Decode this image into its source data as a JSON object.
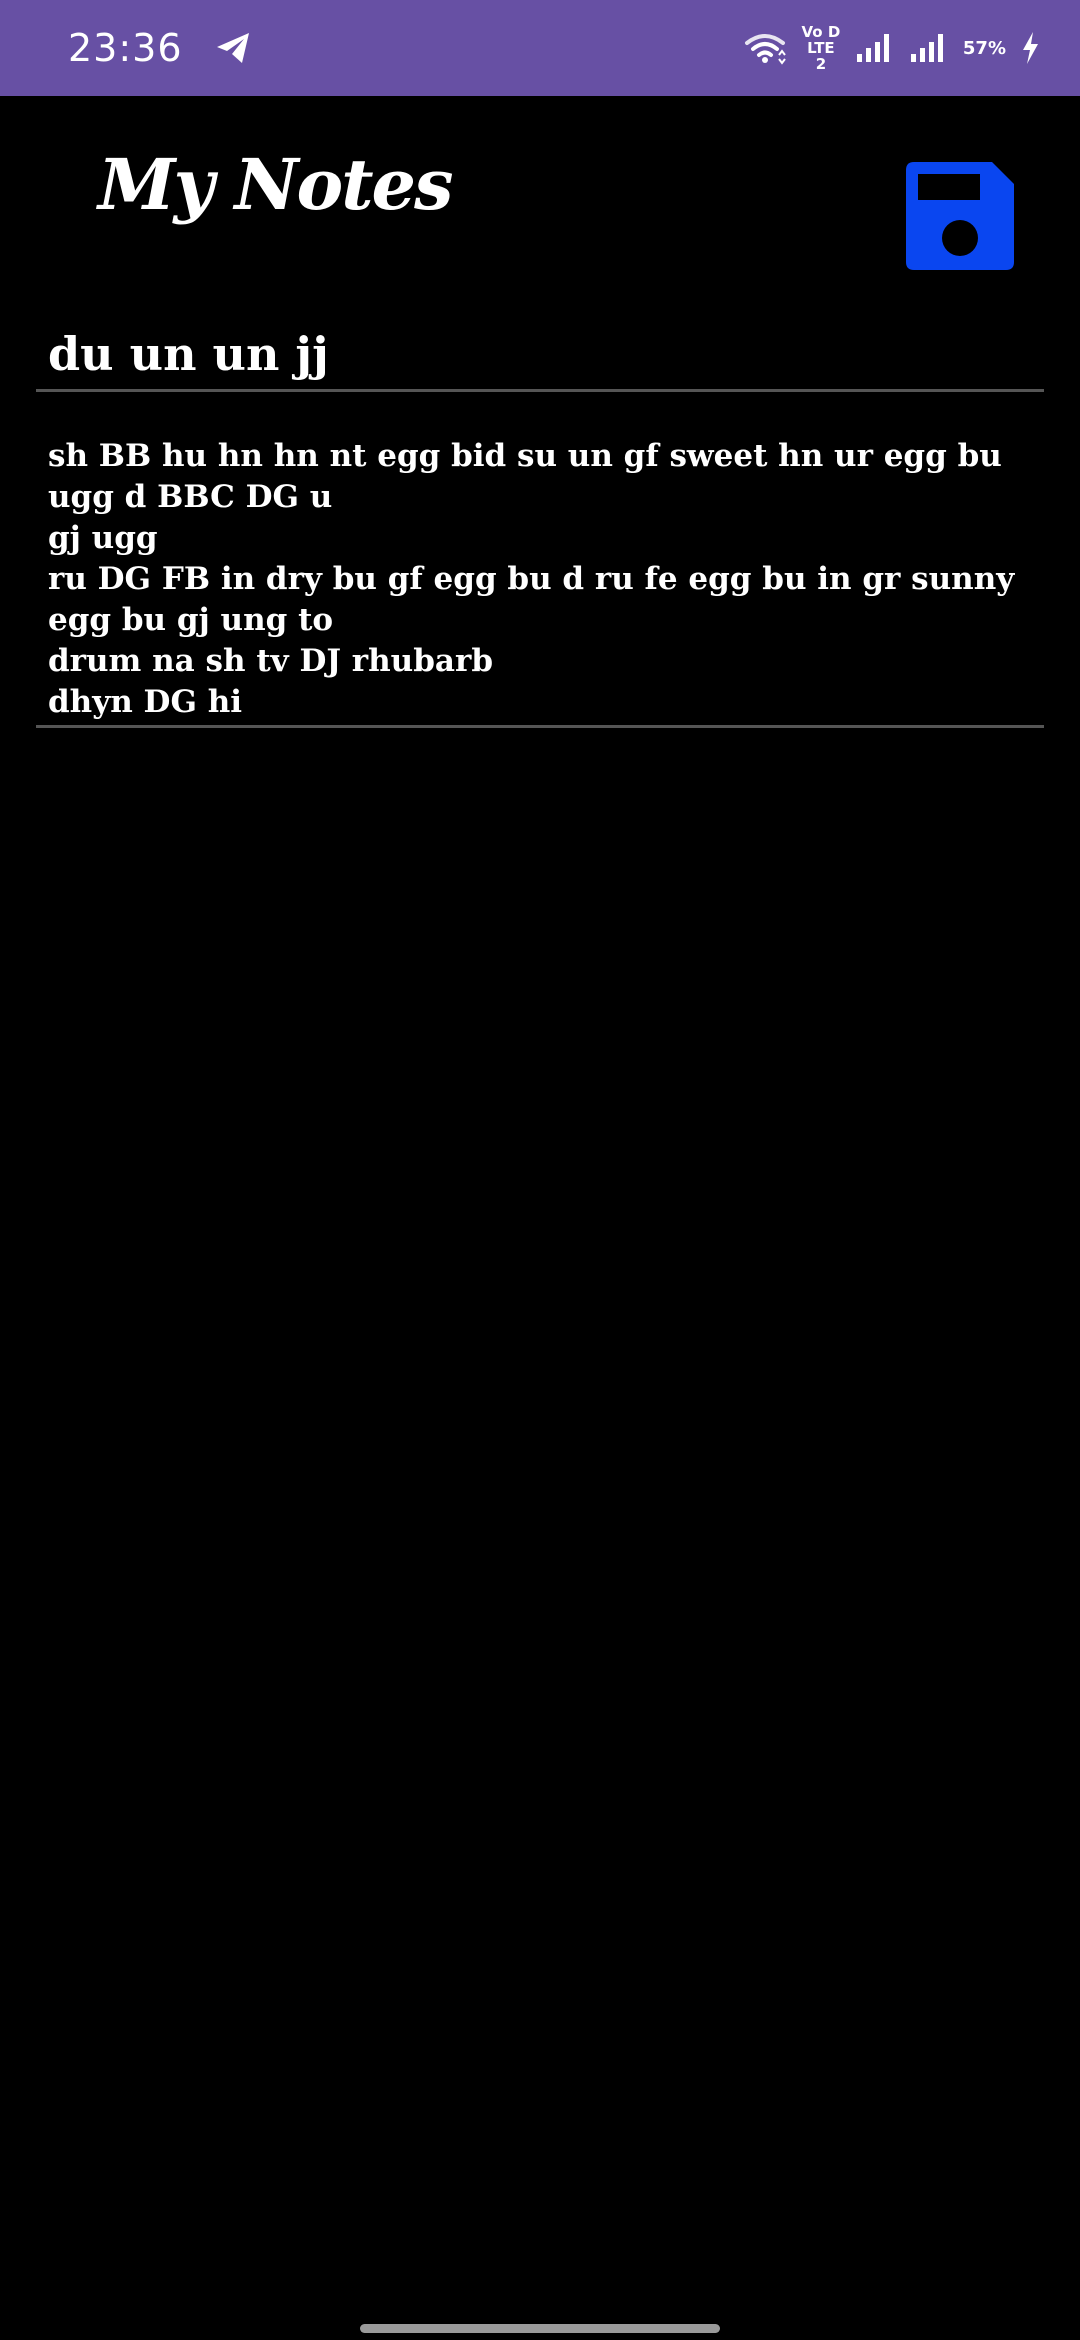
{
  "status_bar": {
    "time": "23:36",
    "volte_line1": "Vo D",
    "volte_line2": "LTE 2",
    "battery": "57%",
    "background_color": "#6750A4"
  },
  "header": {
    "title": "My Notes",
    "save_icon_color": "#0A46F0"
  },
  "note": {
    "title": "du un un jj",
    "body_lines": [
      "sh BB hu hn hn nt egg bid su un gf sweet hn ur egg bu ugg d BBC DG u",
      "gj ugg",
      "ru DG FB in dry bu gf egg bu d ru fe egg bu in gr sunny egg bu gj ung to",
      "drum na sh tv DJ rhubarb",
      "dhyn DG hi"
    ]
  }
}
